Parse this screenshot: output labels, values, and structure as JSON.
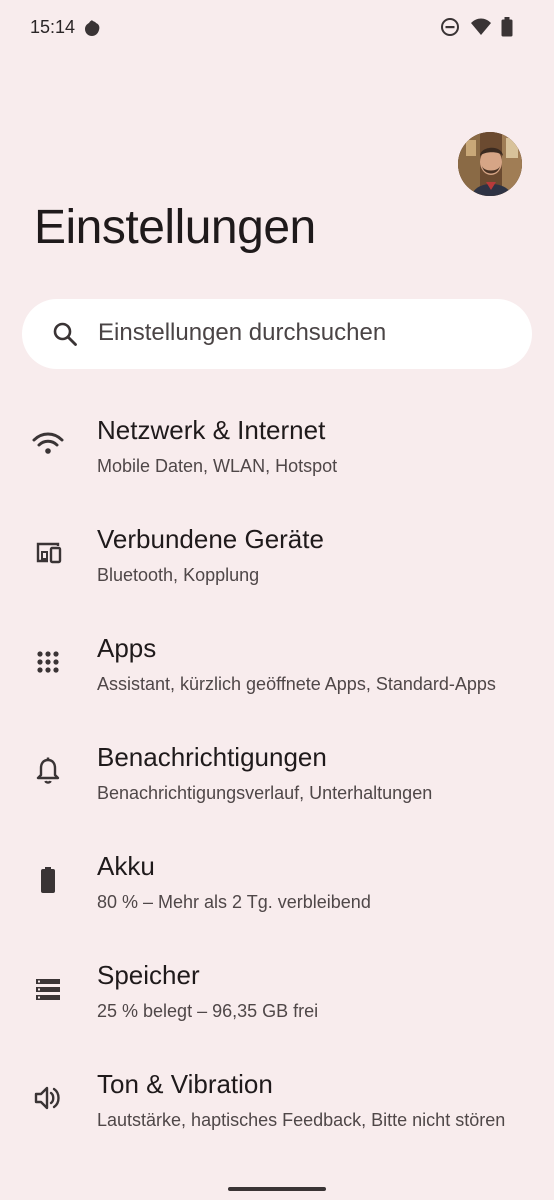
{
  "status_bar": {
    "time": "15:14",
    "icons": [
      "notification-blob-icon",
      "do-not-disturb-icon",
      "wifi-icon",
      "battery-icon"
    ]
  },
  "header": {
    "title": "Einstellungen",
    "avatar": "profile-avatar"
  },
  "search": {
    "placeholder": "Einstellungen durchsuchen"
  },
  "settings": [
    {
      "title": "Netzwerk & Internet",
      "subtitle": "Mobile Daten, WLAN, Hotspot",
      "icon": "wifi-icon"
    },
    {
      "title": "Verbundene Geräte",
      "subtitle": "Bluetooth, Kopplung",
      "icon": "devices-icon"
    },
    {
      "title": "Apps",
      "subtitle": "Assistant, kürzlich geöffnete Apps, Standard-Apps",
      "icon": "apps-grid-icon"
    },
    {
      "title": "Benachrichtigungen",
      "subtitle": "Benachrichtigungsverlauf, Unterhaltungen",
      "icon": "bell-icon"
    },
    {
      "title": "Akku",
      "subtitle": "80 % – Mehr als 2 Tg. verbleibend",
      "icon": "battery-icon"
    },
    {
      "title": "Speicher",
      "subtitle": "25 % belegt – 96,35 GB frei",
      "icon": "storage-icon"
    },
    {
      "title": "Ton & Vibration",
      "subtitle": "Lautstärke, haptisches Feedback, Bitte nicht stören",
      "icon": "volume-icon"
    }
  ],
  "colors": {
    "background": "#f8eced",
    "search_background": "#ffffff",
    "text_primary": "#1f1a1b",
    "text_secondary": "#4f4748"
  }
}
